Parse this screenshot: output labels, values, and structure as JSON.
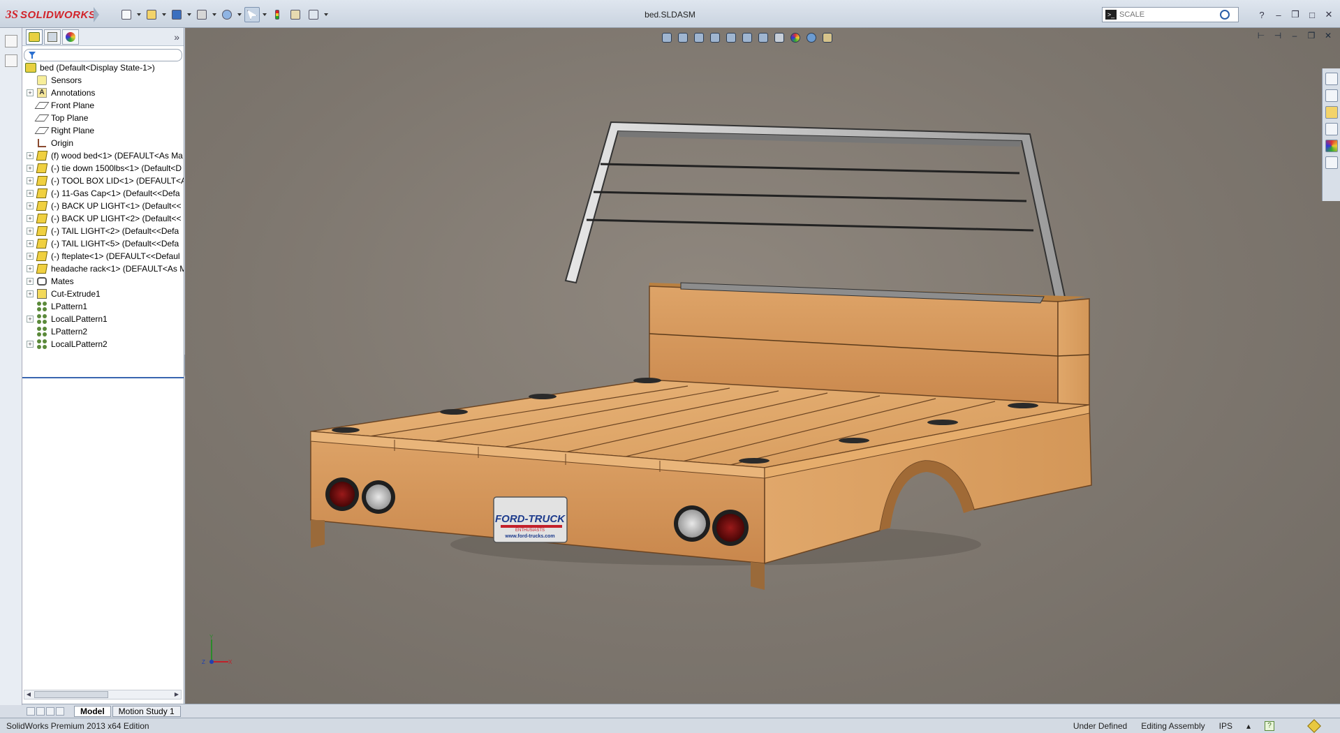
{
  "app": {
    "logo_mark": "3S",
    "logo_text": "SOLIDWORKS",
    "document_title": "bed.SLDASM"
  },
  "search": {
    "placeholder": "SCALE",
    "command_icon": "command-prompt-icon"
  },
  "quick_access": [
    {
      "name": "new-document-button",
      "icon": "new-file-icon"
    },
    {
      "name": "open-button",
      "icon": "folder-open-icon"
    },
    {
      "name": "save-button",
      "icon": "save-icon"
    },
    {
      "name": "print-button",
      "icon": "printer-icon"
    },
    {
      "name": "undo-button",
      "icon": "undo-icon"
    },
    {
      "name": "select-button",
      "icon": "cursor-icon"
    },
    {
      "name": "rebuild-button",
      "icon": "traffic-light-icon"
    },
    {
      "name": "file-properties-button",
      "icon": "properties-icon"
    },
    {
      "name": "options-button",
      "icon": "options-icon"
    }
  ],
  "feature_tree": {
    "root": "bed  (Default<Display State-1>)",
    "items": [
      {
        "label": "Sensors",
        "icon": "sensor-icon",
        "expandable": false
      },
      {
        "label": "Annotations",
        "icon": "annotation-icon",
        "expandable": true
      },
      {
        "label": "Front Plane",
        "icon": "plane-icon",
        "expandable": false
      },
      {
        "label": "Top Plane",
        "icon": "plane-icon",
        "expandable": false
      },
      {
        "label": "Right Plane",
        "icon": "plane-icon",
        "expandable": false
      },
      {
        "label": "Origin",
        "icon": "origin-icon",
        "expandable": false
      },
      {
        "label": "(f) wood bed<1> (DEFAULT<As Ma",
        "icon": "part-icon",
        "expandable": true
      },
      {
        "label": "(-) tie down 1500lbs<1> (Default<D",
        "icon": "part-icon",
        "expandable": true
      },
      {
        "label": "(-) TOOL BOX LID<1> (DEFAULT<A",
        "icon": "part-icon",
        "expandable": true
      },
      {
        "label": "(-) 11-Gas Cap<1> (Default<<Defa",
        "icon": "part-icon",
        "expandable": true
      },
      {
        "label": "(-) BACK UP LIGHT<1> (Default<<",
        "icon": "part-icon",
        "expandable": true
      },
      {
        "label": "(-) BACK UP LIGHT<2> (Default<<",
        "icon": "part-icon",
        "expandable": true
      },
      {
        "label": "(-) TAIL LIGHT<2> (Default<<Defa",
        "icon": "part-icon",
        "expandable": true
      },
      {
        "label": "(-) TAIL LIGHT<5> (Default<<Defa",
        "icon": "part-icon",
        "expandable": true
      },
      {
        "label": "(-) fteplate<1> (DEFAULT<<Defaul",
        "icon": "part-icon",
        "expandable": true
      },
      {
        "label": "headache rack<1> (DEFAULT<As M",
        "icon": "part-icon",
        "expandable": true
      },
      {
        "label": "Mates",
        "icon": "mates-icon",
        "expandable": true
      },
      {
        "label": "Cut-Extrude1",
        "icon": "cut-extrude-icon",
        "expandable": true
      },
      {
        "label": "LPattern1",
        "icon": "pattern-icon",
        "expandable": false
      },
      {
        "label": "LocalLPattern1",
        "icon": "local-pattern-icon",
        "expandable": true
      },
      {
        "label": "LPattern2",
        "icon": "pattern-icon",
        "expandable": false
      },
      {
        "label": "LocalLPattern2",
        "icon": "local-pattern-icon",
        "expandable": true
      }
    ]
  },
  "bottom_tabs": [
    "Model",
    "Motion Study 1"
  ],
  "status": {
    "edition": "SolidWorks Premium 2013 x64 Edition",
    "state": "Under Defined",
    "mode": "Editing Assembly",
    "units": "IPS"
  },
  "model": {
    "plate_brand": "FORD-TRUCK",
    "plate_sub": "ENTHUSIASTS",
    "plate_url": "www.ford-trucks.com",
    "wood_color": "#d9a064",
    "light_red": "#7a1010",
    "light_white": "#c9c9c9"
  },
  "triad": {
    "x": "X",
    "y": "Y",
    "z": "Z"
  }
}
